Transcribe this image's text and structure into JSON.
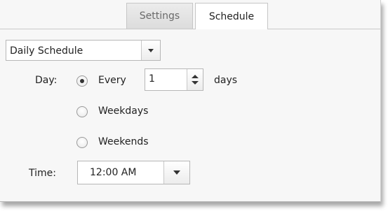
{
  "tabs": [
    {
      "label": "Settings",
      "active": false
    },
    {
      "label": "Schedule",
      "active": true
    }
  ],
  "schedule_type": {
    "selected": "Daily Schedule"
  },
  "day": {
    "label": "Day:",
    "options": {
      "every_label": "Every",
      "every_value": "1",
      "every_unit": "days",
      "weekdays_label": "Weekdays",
      "weekends_label": "Weekends"
    },
    "selected": "Every"
  },
  "time": {
    "label": "Time:",
    "value": "12:00 AM"
  },
  "icons": {
    "schedule_dropdown": "chevron-down-icon",
    "spinner_up": "spin-up-icon",
    "spinner_down": "spin-down-icon",
    "time_dropdown": "chevron-down-icon"
  }
}
